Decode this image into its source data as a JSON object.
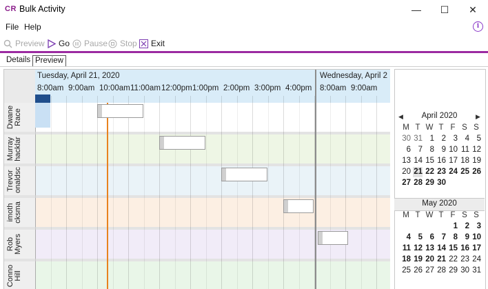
{
  "window": {
    "logo": "CR",
    "title": "Bulk Activity",
    "minimize": "—",
    "maximize": "☐",
    "close": "✕"
  },
  "menu": {
    "file": "File",
    "help": "Help"
  },
  "toolbar": {
    "preview": "Preview",
    "go": "Go",
    "pause": "Pause",
    "stop": "Stop",
    "exit": "Exit"
  },
  "tabs": {
    "details": "Details",
    "preview": "Preview"
  },
  "schedule": {
    "days": [
      {
        "label": "Tuesday, April 21, 2020",
        "times": [
          "8:00am",
          "9:00am",
          "10:00am",
          "11:00am",
          "12:00pm",
          "1:00pm",
          "2:00pm",
          "3:00pm",
          "4:00pm"
        ]
      },
      {
        "label": "Wednesday, April 2",
        "times": [
          "8:00am",
          "9:00am"
        ]
      }
    ],
    "resources": [
      {
        "first": "Dwane",
        "last": "Race",
        "color": "#ffffff"
      },
      {
        "first": "Murray",
        "last": "hacklar",
        "color": "#eef6e5"
      },
      {
        "first": "Trevor",
        "last": "onaldsc",
        "color": "#eaf3f8"
      },
      {
        "first": "imoth",
        "last": "cksma",
        "color": "#fcefe3"
      },
      {
        "first": "Rob",
        "last": "Myers",
        "color": "#f1ecf8"
      },
      {
        "first": "Conno",
        "last": "Hill",
        "color": "#e9f6e8"
      }
    ]
  },
  "calendar": {
    "april": {
      "title": "April 2020",
      "prev": "◀",
      "next": "▶",
      "weekdays": [
        "M",
        "T",
        "W",
        "T",
        "F",
        "S",
        "S"
      ],
      "days": [
        "30",
        "31",
        "1",
        "2",
        "3",
        "4",
        "5",
        "6",
        "7",
        "8",
        "9",
        "10",
        "11",
        "12",
        "13",
        "14",
        "15",
        "16",
        "17",
        "18",
        "19",
        "20",
        "21",
        "22",
        "23",
        "24",
        "25",
        "26",
        "27",
        "28",
        "29",
        "30"
      ]
    },
    "may": {
      "title": "May 2020",
      "weekdays": [
        "M",
        "T",
        "W",
        "T",
        "F",
        "S",
        "S"
      ],
      "days": [
        "1",
        "2",
        "3",
        "4",
        "5",
        "6",
        "7",
        "8",
        "9",
        "10",
        "11",
        "12",
        "13",
        "14",
        "15",
        "16",
        "17",
        "18",
        "19",
        "20",
        "21",
        "22",
        "23",
        "24",
        "25",
        "26",
        "27",
        "28",
        "29",
        "30",
        "31"
      ]
    }
  }
}
